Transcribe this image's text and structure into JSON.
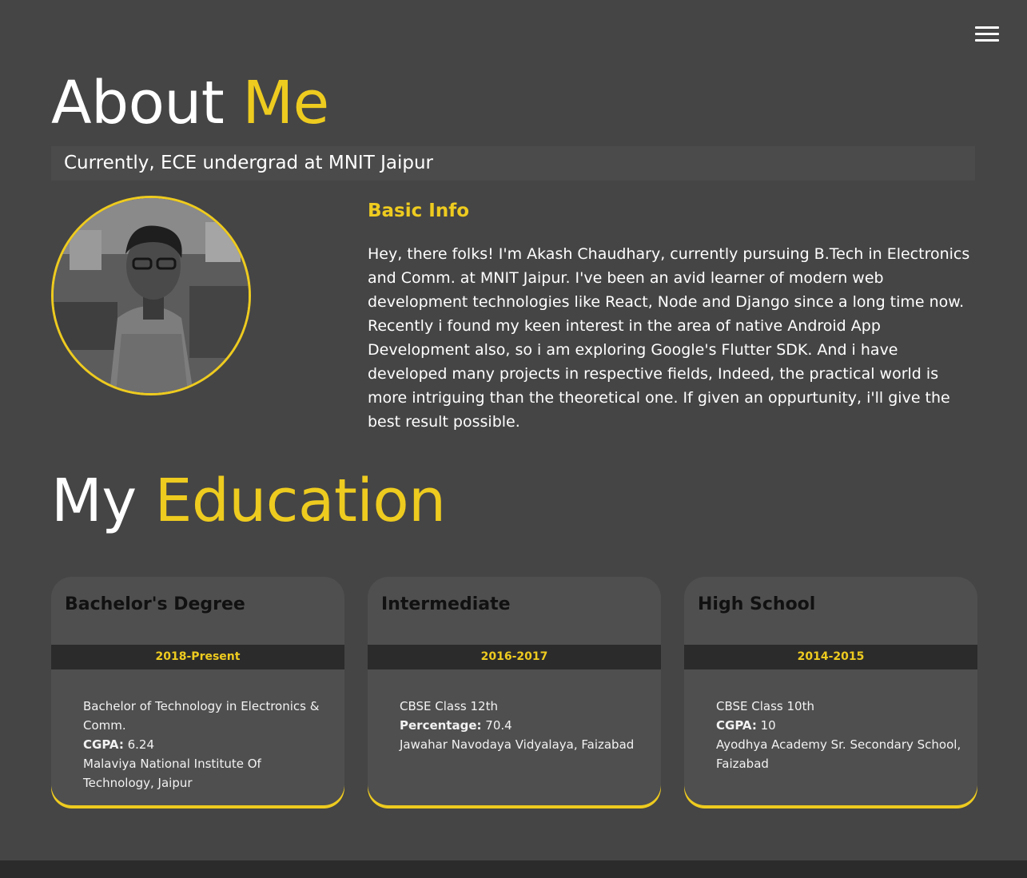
{
  "about": {
    "title_main": "About",
    "title_accent": "Me",
    "subtitle": "Currently, ECE undergrad at MNIT Jaipur",
    "basic_info_title": "Basic Info",
    "basic_info_text": "Hey, there folks! I'm Akash Chaudhary, currently pursuing B.Tech in Electronics and Comm. at MNIT Jaipur. I've been an avid learner of modern web development technologies like React, Node and Django since a long time now. Recently i found my keen interest in the area of native Android App Development also, so i am exploring Google's Flutter SDK. And i have developed many projects in respective fields, Indeed, the practical world is more intriguing than the theoretical one. If given an oppurtunity, i'll give the best result possible."
  },
  "education": {
    "title_main": "My",
    "title_accent": "Education",
    "cards": [
      {
        "title": "Bachelor's Degree",
        "years": "2018-Present",
        "line1": "Bachelor of Technology in Electronics & Comm.",
        "score_label": "CGPA:",
        "score_value": "6.24",
        "institute": "Malaviya National Institute Of Technology, Jaipur"
      },
      {
        "title": "Intermediate",
        "years": "2016-2017",
        "line1": "CBSE Class 12th",
        "score_label": "Percentage:",
        "score_value": "70.4",
        "institute": "Jawahar Navodaya Vidyalaya, Faizabad"
      },
      {
        "title": "High School",
        "years": "2014-2015",
        "line1": "CBSE Class 10th",
        "score_label": "CGPA:",
        "score_value": "10",
        "institute": "Ayodhya Academy Sr. Secondary School, Faizabad"
      }
    ]
  },
  "icons": {
    "menu": "hamburger-menu-icon"
  },
  "colors": {
    "background": "#454545",
    "accent": "#eecb1f",
    "card": "#4f4f4f",
    "dark_bar": "#2b2b2b"
  }
}
